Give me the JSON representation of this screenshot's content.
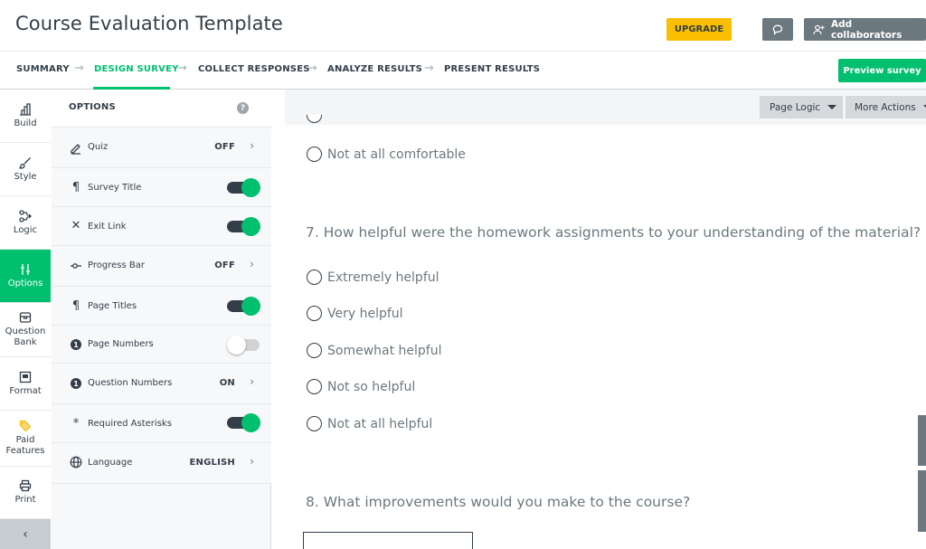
{
  "header": {
    "title": "Course Evaluation Template",
    "upgrade_label": "UPGRADE",
    "add_collaborators_label": "Add collaborators"
  },
  "nav": {
    "steps": [
      "SUMMARY",
      "DESIGN SURVEY",
      "COLLECT RESPONSES",
      "ANALYZE RESULTS",
      "PRESENT RESULTS"
    ],
    "active_step": "DESIGN SURVEY",
    "preview_label": "Preview survey"
  },
  "rail": {
    "items": [
      {
        "label": "Build",
        "icon": "build-icon"
      },
      {
        "label": "Style",
        "icon": "brush-icon"
      },
      {
        "label": "Logic",
        "icon": "logic-icon"
      },
      {
        "label": "Options",
        "icon": "sliders-icon"
      },
      {
        "label": "Question Bank",
        "icon": "question-bank-icon"
      },
      {
        "label": "Format",
        "icon": "format-icon"
      },
      {
        "label": "Paid Features",
        "icon": "tag-icon"
      },
      {
        "label": "Print",
        "icon": "printer-icon"
      }
    ],
    "active_item": "Options",
    "collapse_icon": "chevron-left-icon"
  },
  "panel": {
    "title": "OPTIONS",
    "options": [
      {
        "label": "Quiz",
        "icon": "pencil-icon",
        "value": "OFF",
        "type": "link"
      },
      {
        "label": "Survey Title",
        "icon": "paragraph-icon",
        "on": true,
        "type": "toggle"
      },
      {
        "label": "Exit Link",
        "icon": "x-icon",
        "on": true,
        "type": "toggle"
      },
      {
        "label": "Progress Bar",
        "icon": "progress-icon",
        "value": "OFF",
        "type": "link"
      },
      {
        "label": "Page Titles",
        "icon": "paragraph-icon",
        "on": true,
        "type": "toggle"
      },
      {
        "label": "Page Numbers",
        "icon": "number-icon",
        "on": false,
        "type": "toggle"
      },
      {
        "label": "Question Numbers",
        "icon": "number-icon",
        "value": "ON",
        "type": "link"
      },
      {
        "label": "Required Asterisks",
        "icon": "asterisk-icon",
        "on": true,
        "type": "toggle"
      },
      {
        "label": "Language",
        "icon": "globe-icon",
        "value": "ENGLISH",
        "type": "link"
      }
    ]
  },
  "canvas": {
    "page_logic_label": "Page Logic",
    "more_actions_label": "More Actions",
    "prev_last_choice": "Not at all comfortable",
    "q7": {
      "text": "7. How helpful were the homework assignments to your understanding of the material?",
      "choices": [
        "Extremely helpful",
        "Very helpful",
        "Somewhat helpful",
        "Not so helpful",
        "Not at all helpful"
      ]
    },
    "q8": {
      "text": "8. What improvements would you make to the course?"
    }
  },
  "colors": {
    "accent": "#00bf6f",
    "upgrade": "#f9be00",
    "dark": "#333e48"
  }
}
